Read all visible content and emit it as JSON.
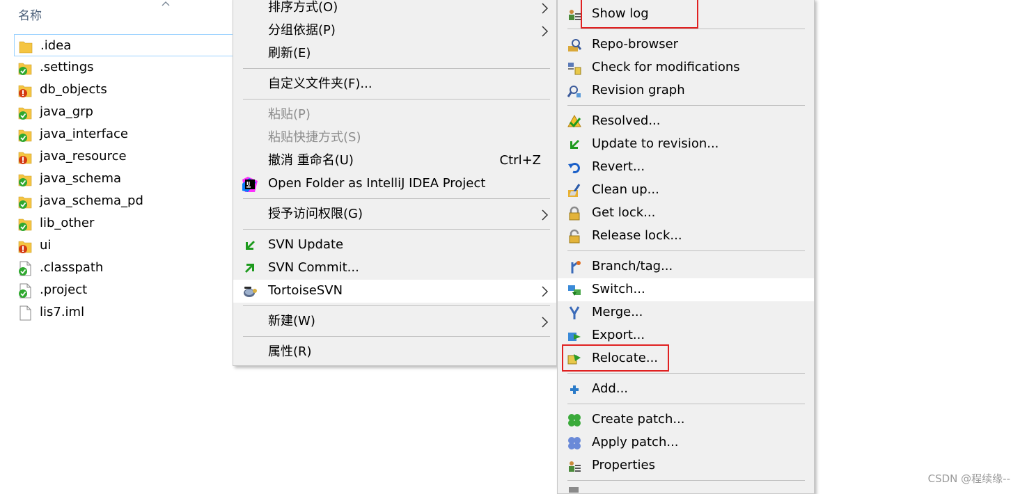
{
  "explorer": {
    "column_header": "名称",
    "files": [
      {
        "name": ".idea",
        "icon": "folder-icon",
        "status": "normal",
        "selected": true
      },
      {
        "name": ".settings",
        "icon": "folder-icon",
        "status": "ok"
      },
      {
        "name": "db_objects",
        "icon": "folder-icon",
        "status": "modified"
      },
      {
        "name": "java_grp",
        "icon": "folder-icon",
        "status": "ok"
      },
      {
        "name": "java_interface",
        "icon": "folder-icon",
        "status": "ok"
      },
      {
        "name": "java_resource",
        "icon": "folder-icon",
        "status": "modified"
      },
      {
        "name": "java_schema",
        "icon": "folder-icon",
        "status": "ok"
      },
      {
        "name": "java_schema_pd",
        "icon": "folder-icon",
        "status": "ok"
      },
      {
        "name": "lib_other",
        "icon": "folder-icon",
        "status": "ok"
      },
      {
        "name": "ui",
        "icon": "folder-icon",
        "status": "modified"
      },
      {
        "name": ".classpath",
        "icon": "file-icon",
        "status": "ok"
      },
      {
        "name": ".project",
        "icon": "file-icon",
        "status": "ok"
      },
      {
        "name": "lis7.iml",
        "icon": "file-icon",
        "status": "none"
      }
    ]
  },
  "context_menu": {
    "items": {
      "sort_by": "排序方式(O)",
      "group_by": "分组依据(P)",
      "refresh": "刷新(E)",
      "customize_folder": "自定义文件夹(F)...",
      "paste": "粘贴(P)",
      "paste_shortcut": "粘贴快捷方式(S)",
      "undo_rename": "撤消 重命名(U)",
      "undo_shortcut": "Ctrl+Z",
      "open_intellij": "Open Folder as IntelliJ IDEA Project",
      "give_access": "授予访问权限(G)",
      "svn_update": "SVN Update",
      "svn_commit": "SVN Commit...",
      "tortoise_svn": "TortoiseSVN",
      "new": "新建(W)",
      "properties": "属性(R)"
    }
  },
  "tortoise_menu": {
    "items": {
      "show_log": "Show log",
      "repo_browser": "Repo-browser",
      "check_modifications": "Check for modifications",
      "revision_graph": "Revision graph",
      "resolved": "Resolved...",
      "update_to_revision": "Update to revision...",
      "revert": "Revert...",
      "clean_up": "Clean up...",
      "get_lock": "Get lock...",
      "release_lock": "Release lock...",
      "branch_tag": "Branch/tag...",
      "switch": "Switch...",
      "merge": "Merge...",
      "export": "Export...",
      "relocate": "Relocate...",
      "add": "Add...",
      "create_patch": "Create patch...",
      "apply_patch": "Apply patch...",
      "properties": "Properties"
    }
  },
  "watermark": "CSDN @程续缘--",
  "colors": {
    "menu_bg": "#f0f0f0",
    "highlight_bg": "#ffffff",
    "annotation_red": "#e02020",
    "svn_ok_green": "#2fa82f",
    "svn_modified_red": "#d43a12",
    "folder_yellow": "#f5c542"
  }
}
